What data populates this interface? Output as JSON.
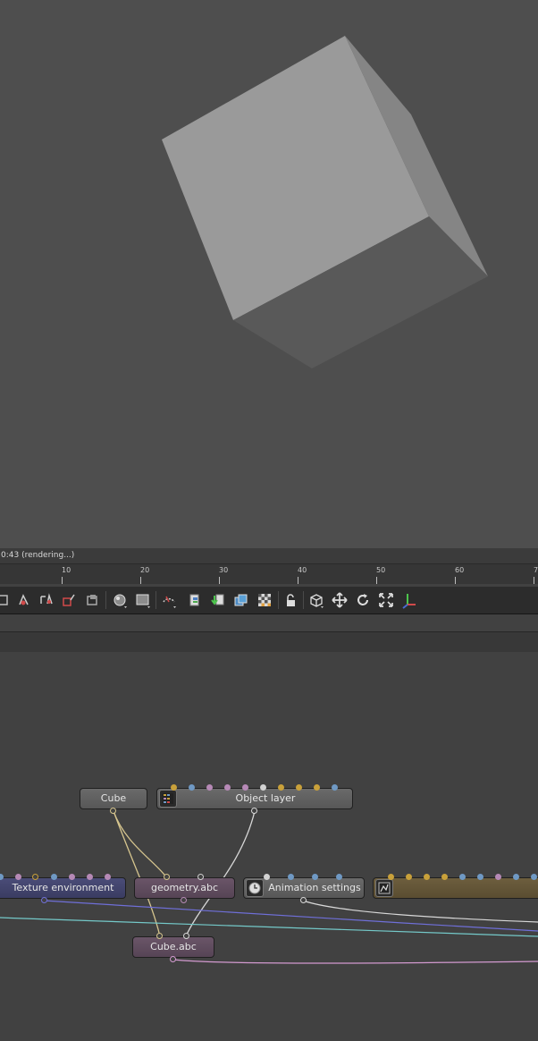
{
  "status": {
    "text": "0:43 (rendering...)"
  },
  "timeline": {
    "ticks": [
      "10",
      "20",
      "30",
      "40",
      "50",
      "60",
      "7"
    ]
  },
  "toolbar": {
    "tools": [
      "render-region-icon",
      "picking-icon",
      "focus-picker-icon",
      "camera-picker-icon",
      "bounding-box-icon",
      "render-filter-icon",
      "display-mode-icon",
      "priority-icon",
      "copy-icon",
      "import-icon",
      "layers-icon",
      "alpha-checker-icon",
      "lock-icon",
      "cube-view-icon",
      "move-icon",
      "reset-icon",
      "fit-icon",
      "axis-icon"
    ]
  },
  "graph": {
    "nodes": {
      "cube": "Cube",
      "object_layer": "Object layer",
      "texture_environment": "Texture environment",
      "geometry_abc": "geometry.abc",
      "animation_settings": "Animation settings",
      "cube_abc": "Cube.abc"
    }
  },
  "colors": {
    "pin_yellow": "#c9a13a",
    "pin_blue": "#6f99c4",
    "pin_pink": "#b689b6",
    "pin_white": "#d2d2d2",
    "wire_yellow": "#d6c58e",
    "wire_white": "#d8d8d8",
    "wire_blue": "#6f6fd8",
    "wire_cyan": "#74c9c9",
    "wire_pink": "#d39ad0"
  }
}
